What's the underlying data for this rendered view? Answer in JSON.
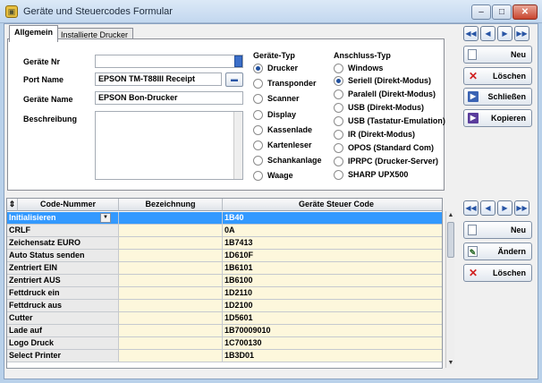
{
  "window": {
    "title": "Geräte und Steuercodes Formular",
    "btn_min": "–",
    "btn_max": "□",
    "btn_close": "✕"
  },
  "tabs": [
    {
      "label": "Allgemein"
    },
    {
      "label": "Installierte Drucker"
    }
  ],
  "form": {
    "geraete_nr_label": "Geräte Nr",
    "geraete_nr_value": "",
    "port_name_label": "Port Name",
    "port_name_value": "EPSON TM-T88III Receipt",
    "geraete_name_label": "Geräte Name",
    "geraete_name_value": "EPSON Bon-Drucker",
    "beschreibung_label": "Beschreibung",
    "beschreibung_value": ""
  },
  "geraete_typ": {
    "title": "Geräte-Typ",
    "options": [
      "Drucker",
      "Transponder",
      "Scanner",
      "Display",
      "Kassenlade",
      "Kartenleser",
      "Schankanlage",
      "Waage"
    ],
    "selected": "Drucker"
  },
  "anschluss_typ": {
    "title": "Anschluss-Typ",
    "options": [
      "Windows",
      "Seriell (Direkt-Modus)",
      "Paralell (Direkt-Modus)",
      "USB (Direkt-Modus)",
      "USB (Tastatur-Emulation)",
      "IR (Direkt-Modus)",
      "OPOS (Standard Com)",
      "IPRPC (Drucker-Server)",
      "SHARP UPX500"
    ],
    "selected": "Seriell (Direkt-Modus)"
  },
  "nav_glyphs": {
    "first": "◀◀",
    "prev": "◀",
    "next": "▶",
    "last": "▶▶"
  },
  "top_buttons": {
    "neu": "Neu",
    "loeschen": "Löschen",
    "schliessen": "Schließen",
    "kopieren": "Kopieren"
  },
  "bottom_buttons": {
    "neu": "Neu",
    "aendern": "Ändern",
    "loeschen": "Löschen"
  },
  "grid": {
    "columns": [
      "Code-Nummer",
      "Bezeichnung",
      "Geräte Steuer Code"
    ],
    "rows": [
      {
        "code": "Initialisieren",
        "bez": "",
        "steuer": "1B40"
      },
      {
        "code": "CRLF",
        "bez": "",
        "steuer": "0A"
      },
      {
        "code": "Zeichensatz EURO",
        "bez": "",
        "steuer": "1B7413"
      },
      {
        "code": "Auto Status senden",
        "bez": "",
        "steuer": "1D610F"
      },
      {
        "code": "Zentriert EIN",
        "bez": "",
        "steuer": "1B6101"
      },
      {
        "code": "Zentriert AUS",
        "bez": "",
        "steuer": "1B6100"
      },
      {
        "code": "Fettdruck ein",
        "bez": "",
        "steuer": "1D2110"
      },
      {
        "code": "Fettdruck aus",
        "bez": "",
        "steuer": "1D2100"
      },
      {
        "code": "Cutter",
        "bez": "",
        "steuer": "1D5601"
      },
      {
        "code": "Lade auf",
        "bez": "",
        "steuer": "1B70009010"
      },
      {
        "code": "Logo Druck",
        "bez": "",
        "steuer": "1C700130"
      },
      {
        "code": "Select Printer",
        "bez": "",
        "steuer": "1B3D01"
      }
    ]
  }
}
